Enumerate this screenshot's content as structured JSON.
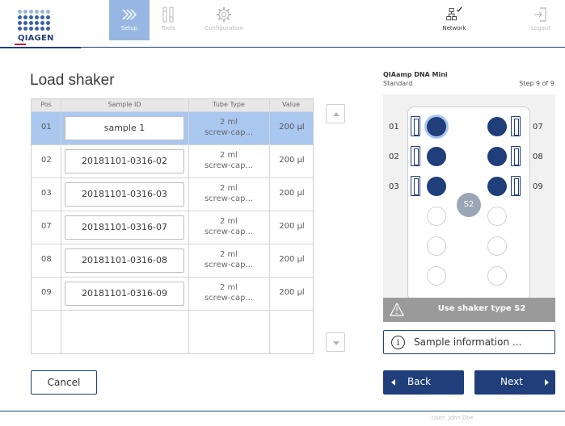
{
  "brand": {
    "name": "QIAGEN",
    "color": "#1f3e7a",
    "accent": "#c8102e"
  },
  "nav": {
    "tabs": [
      {
        "label": "Setup",
        "icon": "setup-chevrons-icon",
        "state": "active"
      },
      {
        "label": "Tools",
        "icon": "tools-icon",
        "state": "dim"
      },
      {
        "label": "Configuration",
        "icon": "gear-icon",
        "state": "dim"
      },
      {
        "label": "Network",
        "icon": "network-icon",
        "state": "normal",
        "status": "connected"
      },
      {
        "label": "Logout",
        "icon": "logout-icon",
        "state": "dim"
      }
    ]
  },
  "page": {
    "title": "Load shaker"
  },
  "table": {
    "headers": {
      "pos": "Pos",
      "sample_id": "Sample ID",
      "tube_type": "Tube Type",
      "value": "Value"
    },
    "rows": [
      {
        "pos": "01",
        "sample_id": "sample 1",
        "tube_line1": "2 ml",
        "tube_line2": "screw-cap...",
        "value": "200 µl",
        "selected": true
      },
      {
        "pos": "02",
        "sample_id": "20181101-0316-02",
        "tube_line1": "2 ml",
        "tube_line2": "screw-cap...",
        "value": "200 µl"
      },
      {
        "pos": "03",
        "sample_id": "20181101-0316-03",
        "tube_line1": "2 ml",
        "tube_line2": "screw-cap...",
        "value": "200 µl"
      },
      {
        "pos": "07",
        "sample_id": "20181101-0316-07",
        "tube_line1": "2 ml",
        "tube_line2": "screw-cap...",
        "value": "200 µl"
      },
      {
        "pos": "08",
        "sample_id": "20181101-0316-08",
        "tube_line1": "2 ml",
        "tube_line2": "screw-cap...",
        "value": "200 µl"
      },
      {
        "pos": "09",
        "sample_id": "20181101-0316-09",
        "tube_line1": "2 ml",
        "tube_line2": "screw-cap...",
        "value": "200 µl"
      }
    ],
    "selected_color": "#a9c7ef"
  },
  "buttons": {
    "cancel": "Cancel",
    "back": "Back",
    "next": "Next",
    "sample_info": "Sample information ..."
  },
  "protocol": {
    "name": "QIAamp DNA Mini",
    "variant": "Standard",
    "step": "Step 9 of 9"
  },
  "shaker": {
    "type_badge": "S2",
    "left_positions": [
      "01",
      "02",
      "03"
    ],
    "right_positions": [
      "07",
      "08",
      "09"
    ],
    "warning": "Use shaker type S2"
  },
  "footer": {
    "user": "User: John Doe"
  }
}
